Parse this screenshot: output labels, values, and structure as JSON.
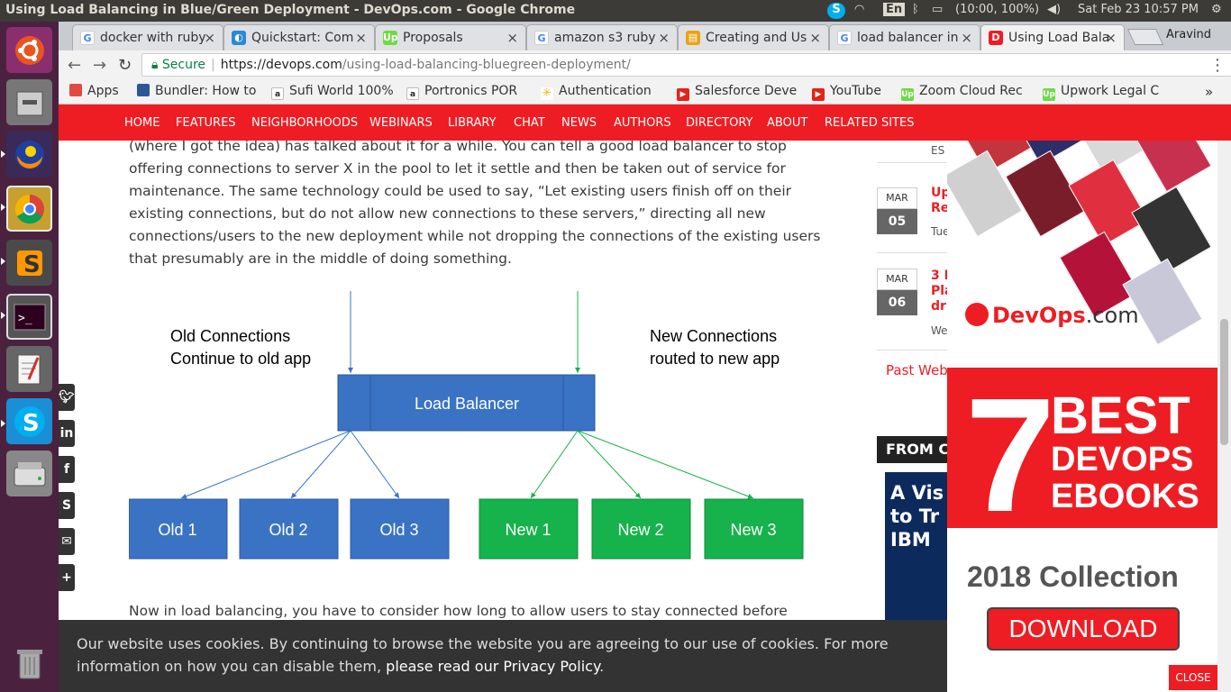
{
  "os": {
    "window_title": "Using Load Balancing in Blue/Green Deployment - DevOps.com - Google Chrome",
    "keyboard": "En",
    "battery": "(10:00, 100%)",
    "clock": "Sat Feb 23 10:57 PM"
  },
  "launcher": [
    "ubuntu",
    "files",
    "firefox",
    "chrome",
    "sublime",
    "terminal",
    "text-editor",
    "skype",
    "disk",
    "trash"
  ],
  "tabs": [
    {
      "label": "docker with ruby",
      "fav": "G",
      "color": "#4285f4"
    },
    {
      "label": "Quickstart: Com",
      "fav": "◐",
      "color": "#2a8ad4"
    },
    {
      "label": "Proposals",
      "fav": "Up",
      "color": "#6fda44"
    },
    {
      "label": "amazon s3 ruby",
      "fav": "G",
      "color": "#4285f4"
    },
    {
      "label": "Creating and Us",
      "fav": "▤",
      "color": "#e8a317"
    },
    {
      "label": "load balancer in",
      "fav": "G",
      "color": "#4285f4"
    },
    {
      "label": "Using Load Bala",
      "fav": "D",
      "color": "#ee1d23"
    }
  ],
  "profile": "Aravind",
  "address": {
    "secure": "Secure",
    "host": "https://devops.com",
    "path": "/using-load-balancing-bluegreen-deployment/"
  },
  "bookmarks": [
    {
      "label": "Apps",
      "color": "#e04a3f"
    },
    {
      "label": "Bundler: How to",
      "color": "#2b5797"
    },
    {
      "label": "Sufi World 100%",
      "color": "#222"
    },
    {
      "label": "Portronics POR",
      "color": "#222"
    },
    {
      "label": "Authentication",
      "color": "#f5b400"
    },
    {
      "label": "Salesforce Deve",
      "color": "#e62117"
    },
    {
      "label": "YouTube",
      "color": "#e62117"
    },
    {
      "label": "Zoom Cloud Rec",
      "color": "#6fda44"
    },
    {
      "label": "Upwork Legal C",
      "color": "#6fda44"
    }
  ],
  "site_nav": [
    "HOME",
    "FEATURES",
    "NEIGHBORHOODS",
    "WEBINARS",
    "LIBRARY",
    "CHAT",
    "NEWS",
    "AUTHORS",
    "DIRECTORY",
    "ABOUT",
    "RELATED SITES"
  ],
  "article": {
    "p1": "(where I got the idea) has talked about it for a while. You can tell a good load balancer to stop offering connections to server X in the pool to let it settle and then be taken out of service for maintenance. The same technology could be used to say, “Let existing users finish off on their existing connections, but do not allow new connections to these servers,” directing all new connections/users to the new deployment while not dropping the connections of the existing users that presumably are in the middle of doing something.",
    "p2": "Now in load balancing, you have to consider how long to allow users to stay connected before"
  },
  "diagram": {
    "old_label_1": "Old Connections",
    "old_label_2": "Continue to old app",
    "new_label_1": "New Connections",
    "new_label_2": "routed to new app",
    "lb": "Load Balancer",
    "old": [
      "Old 1",
      "Old 2",
      "Old 3"
    ],
    "new": [
      "New 1",
      "New 2",
      "New 3"
    ],
    "old_color": "#3a73c4",
    "new_color": "#16b24b"
  },
  "share": [
    "twitter",
    "linkedin",
    "facebook",
    "stumbleupon",
    "email",
    "plus"
  ],
  "sidebar": {
    "top_meta": "ES",
    "events": [
      {
        "mon": "MAR",
        "day": "05",
        "title": "Up\nRe",
        "meta": "Tue"
      },
      {
        "mon": "MAR",
        "day": "06",
        "title": "3 R\nPla\ndri",
        "meta": "We"
      }
    ],
    "past": "Past Web",
    "from": "FROM C",
    "ibm": "A Vis\nto Tr\nIBM"
  },
  "ad": {
    "logo_prefix": "Dev",
    "logo_suffix": "Ops",
    "logo_tail": ".com",
    "seven": "7",
    "best": "BEST",
    "devops": "DEVOPS",
    "ebooks": "EBOOKS",
    "collection": "2018 Collection",
    "download": "DOWNLOAD"
  },
  "cookie": {
    "text": "Our website uses cookies. By continuing to browse the website you are agreeing to our use of cookies. For more information on how you can disable them, ",
    "link": "please read our Privacy Policy",
    "end": ".",
    "close": "CLOSE"
  },
  "colors": {
    "brand": "#ee1d23",
    "launcher": "#4a2240",
    "topbar": "#3c3b37"
  }
}
